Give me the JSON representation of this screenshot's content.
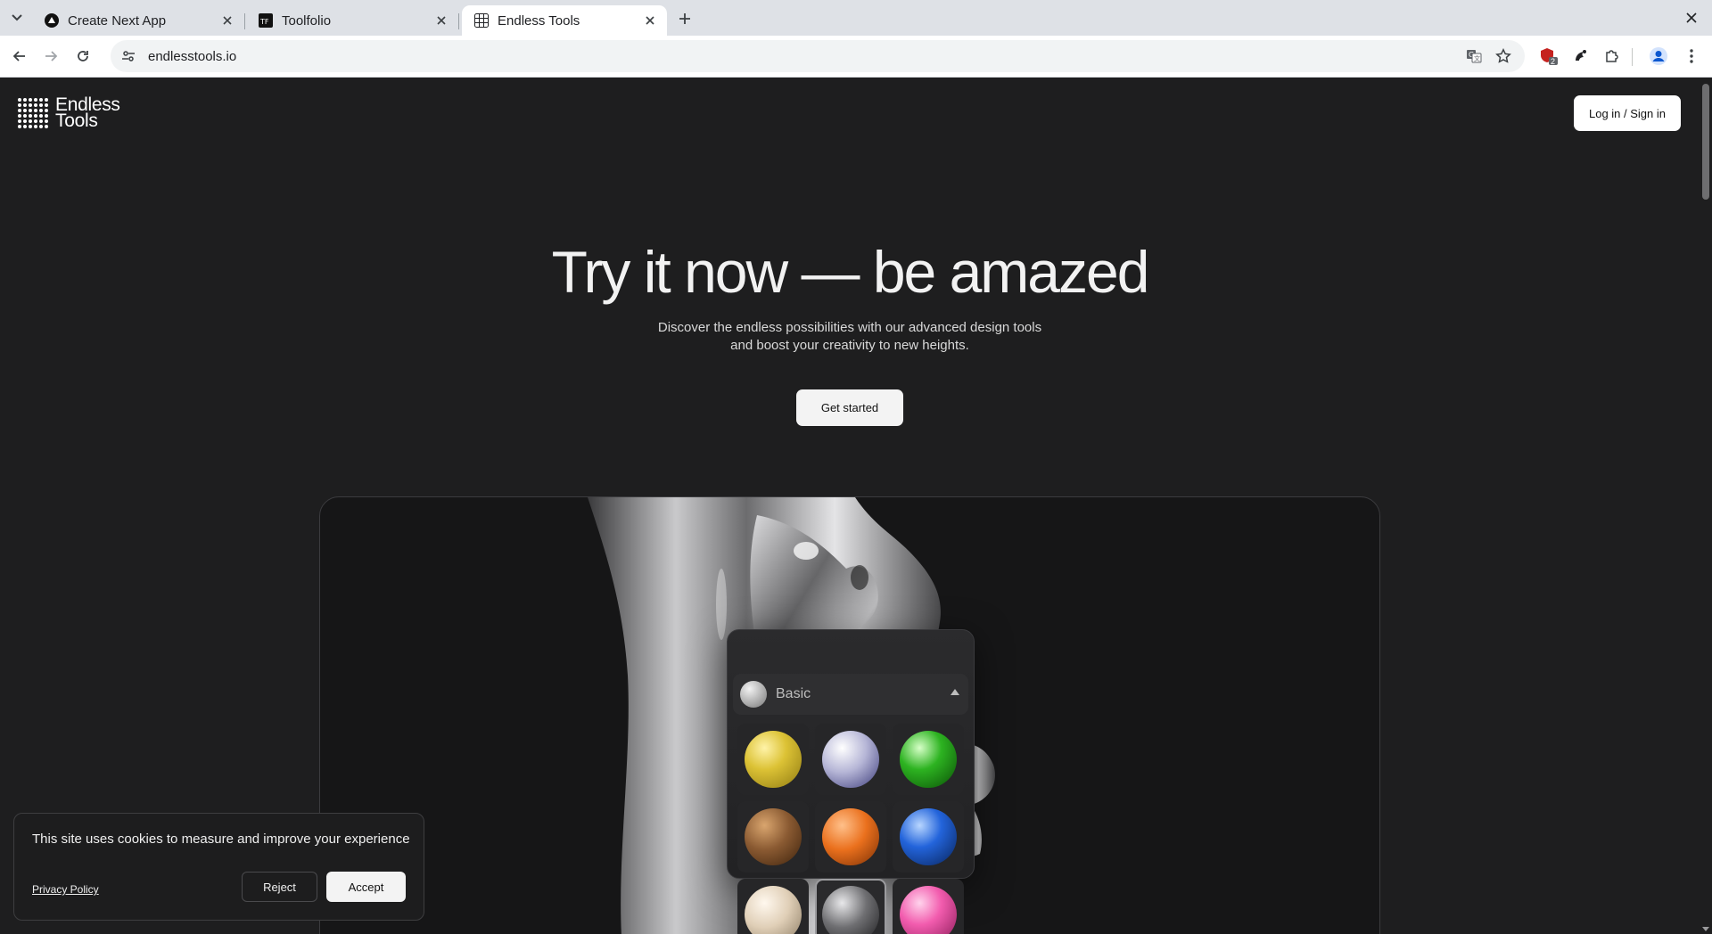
{
  "browser": {
    "tabs": [
      {
        "title": "Create Next App",
        "favicon": "vercel-triangle-icon",
        "active": false
      },
      {
        "title": "Toolfolio",
        "favicon": "toolfolio-icon",
        "active": false
      },
      {
        "title": "Endless Tools",
        "favicon": "endless-tools-grid-icon",
        "active": true
      }
    ],
    "address": "endlesstools.io",
    "extension_badge": "2"
  },
  "site": {
    "logo_line1": "Endless",
    "logo_line2": "Tools",
    "login_label": "Log in / Sign in"
  },
  "hero": {
    "title": "Try it now — be amazed",
    "subtitle_line1": "Discover the endless possibilities with our advanced design tools",
    "subtitle_line2": "and boost your creativity to new heights.",
    "cta_label": "Get started"
  },
  "material_panel": {
    "category": "Basic",
    "materials": [
      {
        "name": "yellow-matte",
        "color": "#d9c03a"
      },
      {
        "name": "blue-marble",
        "color": "#b8b8d8"
      },
      {
        "name": "green-glossy",
        "color": "#2aa71f"
      },
      {
        "name": "wood",
        "color": "#8a5a32"
      },
      {
        "name": "orange-tile",
        "color": "#e86f1d"
      },
      {
        "name": "blue-glossy",
        "color": "#1f5fd6"
      },
      {
        "name": "cracked-ceramic",
        "color": "#e3d4c0"
      },
      {
        "name": "glass",
        "color": "#6f6f72"
      },
      {
        "name": "pink-glossy",
        "color": "#f25cae"
      }
    ]
  },
  "cookie_banner": {
    "message": "This site uses cookies to measure and improve your experience",
    "policy_label": "Privacy Policy",
    "reject_label": "Reject",
    "accept_label": "Accept"
  }
}
